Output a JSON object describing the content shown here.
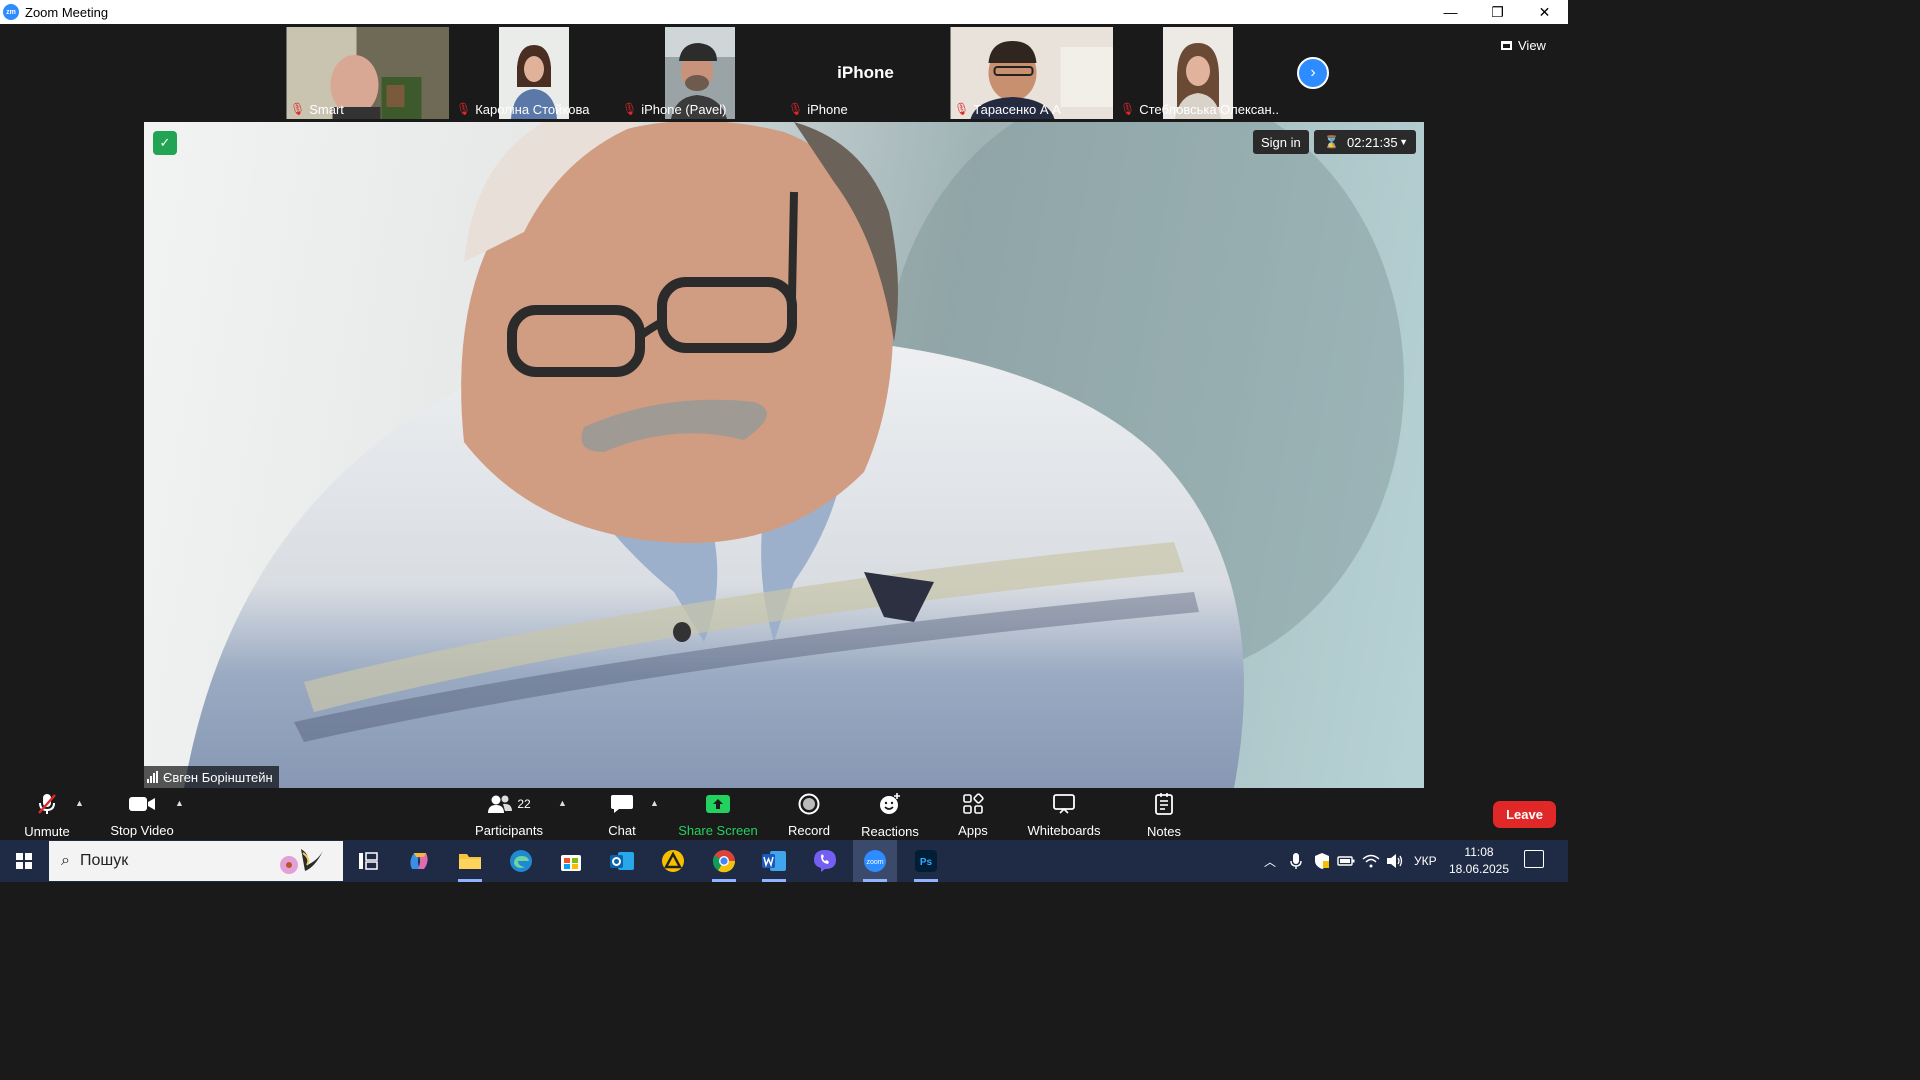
{
  "window": {
    "app_icon": "zm",
    "title": "Zoom Meeting",
    "controls": {
      "minimize": "—",
      "restore": "❐",
      "close": "✕"
    }
  },
  "thumbnails": [
    {
      "name": "Smart",
      "muted": true,
      "icon": "mic-off-icon"
    },
    {
      "name": "Кароліна Стойкова",
      "muted": true,
      "icon": "mic-off-icon"
    },
    {
      "name": "iPhone (Pavel)",
      "muted": true,
      "icon": "mic-off-icon"
    },
    {
      "name": "iPhone",
      "big_label": "iPhone",
      "muted": true,
      "icon": "mic-off-icon"
    },
    {
      "name": "Тарасенко А А",
      "muted": true,
      "icon": "mic-off-icon"
    },
    {
      "name": "Стебловська Олексан...",
      "muted": true,
      "icon": "mic-off-icon"
    }
  ],
  "strip_next_icon": "chevron-right-icon",
  "view_button": {
    "label": "View",
    "icon": "grid-icon"
  },
  "main_video": {
    "speaker_name": "Євген Борінштейн",
    "sign_in_label": "Sign in",
    "timer": "02:21:35",
    "security_icon": "shield-check-icon"
  },
  "toolbar": {
    "unmute": "Unmute",
    "stop_video": "Stop Video",
    "participants": "Participants",
    "participants_count": "22",
    "chat": "Chat",
    "share_screen": "Share Screen",
    "record": "Record",
    "reactions": "Reactions",
    "apps": "Apps",
    "whiteboards": "Whiteboards",
    "notes": "Notes",
    "leave": "Leave"
  },
  "taskbar": {
    "search_placeholder": "Пошук",
    "language": "УКР",
    "time": "11:08",
    "date": "18.06.2025",
    "apps": [
      "task-view",
      "copilot",
      "file-explorer",
      "edge",
      "microsoft-store",
      "outlook",
      "app-triangle",
      "chrome",
      "word",
      "viber",
      "zoom",
      "photoshop"
    ]
  },
  "colors": {
    "accent": "#2d8cff",
    "leave": "#e02828",
    "share": "#23d160",
    "security": "#23a455"
  }
}
